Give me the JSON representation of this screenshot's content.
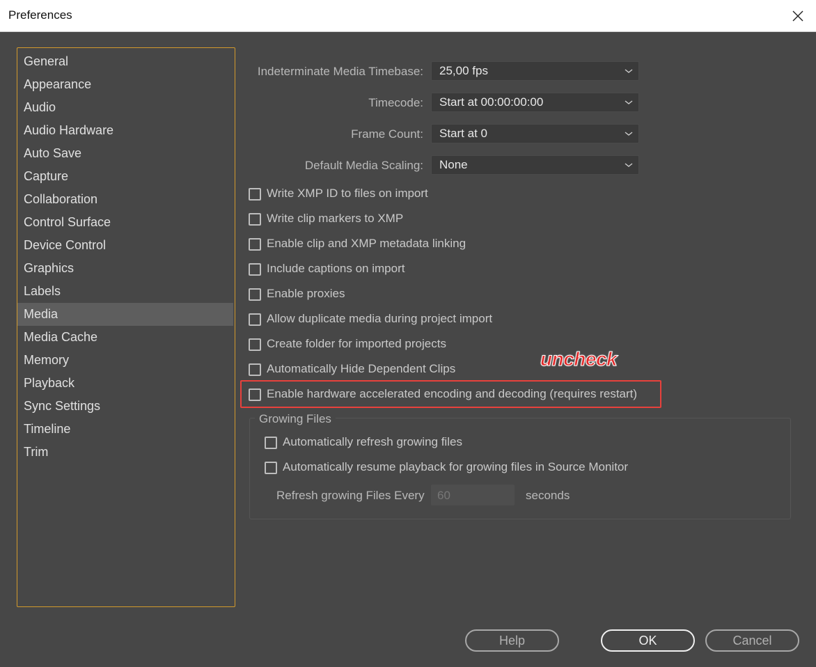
{
  "window": {
    "title": "Preferences",
    "close_icon": "close-icon"
  },
  "sidebar": {
    "items": [
      "General",
      "Appearance",
      "Audio",
      "Audio Hardware",
      "Auto Save",
      "Capture",
      "Collaboration",
      "Control Surface",
      "Device Control",
      "Graphics",
      "Labels",
      "Media",
      "Media Cache",
      "Memory",
      "Playback",
      "Sync Settings",
      "Timeline",
      "Trim"
    ],
    "selected": "Media",
    "border_color": "#d39a2c"
  },
  "fields": {
    "timebase": {
      "label": "Indeterminate Media Timebase:",
      "value": "25,00 fps"
    },
    "timecode": {
      "label": "Timecode:",
      "value": "Start at 00:00:00:00"
    },
    "frame_count": {
      "label": "Frame Count:",
      "value": "Start at 0"
    },
    "scaling": {
      "label": "Default Media Scaling:",
      "value": "None"
    }
  },
  "checkboxes": [
    {
      "label": "Write XMP ID to files on import",
      "checked": false
    },
    {
      "label": "Write clip markers to XMP",
      "checked": false
    },
    {
      "label": "Enable clip and XMP metadata linking",
      "checked": false
    },
    {
      "label": "Include captions on import",
      "checked": false
    },
    {
      "label": "Enable proxies",
      "checked": false
    },
    {
      "label": "Allow duplicate media during project import",
      "checked": false
    },
    {
      "label": "Create folder for imported projects",
      "checked": false
    },
    {
      "label": "Automatically Hide Dependent Clips",
      "checked": false
    },
    {
      "label": "Enable hardware accelerated encoding and decoding (requires restart)",
      "checked": false
    }
  ],
  "annotation": {
    "text": "uncheck",
    "color": "#e02a2a"
  },
  "growing_files": {
    "title": "Growing Files",
    "auto_refresh": {
      "label": "Automatically refresh growing files",
      "checked": false
    },
    "auto_resume": {
      "label": "Automatically resume playback for growing files in Source Monitor",
      "checked": false
    },
    "refresh_label": "Refresh growing Files Every",
    "refresh_value": "60",
    "refresh_unit": "seconds"
  },
  "buttons": {
    "help": "Help",
    "ok": "OK",
    "cancel": "Cancel"
  }
}
